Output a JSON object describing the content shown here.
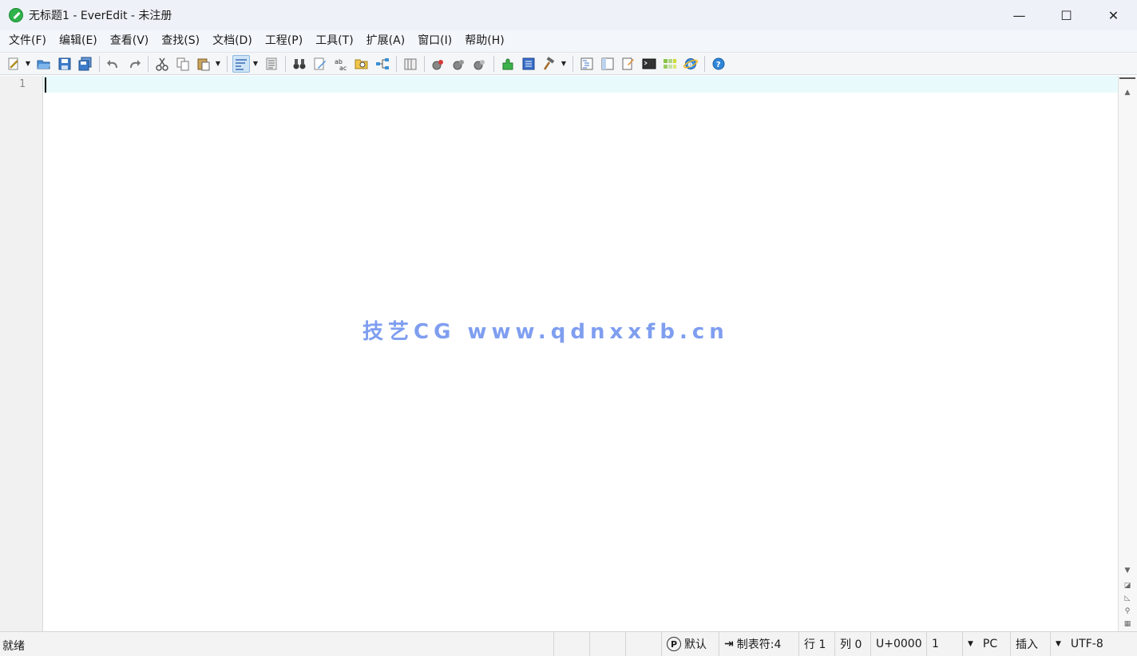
{
  "window": {
    "title": "无标题1 - EverEdit - 未注册",
    "minimize": "—",
    "maximize": "☐",
    "close": "✕"
  },
  "menu": [
    {
      "label": "文件(F)"
    },
    {
      "label": "编辑(E)"
    },
    {
      "label": "查看(V)"
    },
    {
      "label": "查找(S)"
    },
    {
      "label": "文档(D)"
    },
    {
      "label": "工程(P)"
    },
    {
      "label": "工具(T)"
    },
    {
      "label": "扩展(A)"
    },
    {
      "label": "窗口(I)"
    },
    {
      "label": "帮助(H)"
    }
  ],
  "editor": {
    "line_number": "1",
    "current_line_color": "#e8fafc"
  },
  "watermark": "技艺CG www.qdnxxfb.cn",
  "status": {
    "ready": "就绪",
    "theme": "默认",
    "tab": "制表符:4",
    "line": "行 1",
    "col": "列 0",
    "unicode": "U+0000",
    "sel": "1",
    "eol": "PC",
    "mode": "插入",
    "encoding": "UTF-8"
  },
  "colors": {
    "accent": "#2fb34a",
    "watermark": "#7f9ef0"
  }
}
